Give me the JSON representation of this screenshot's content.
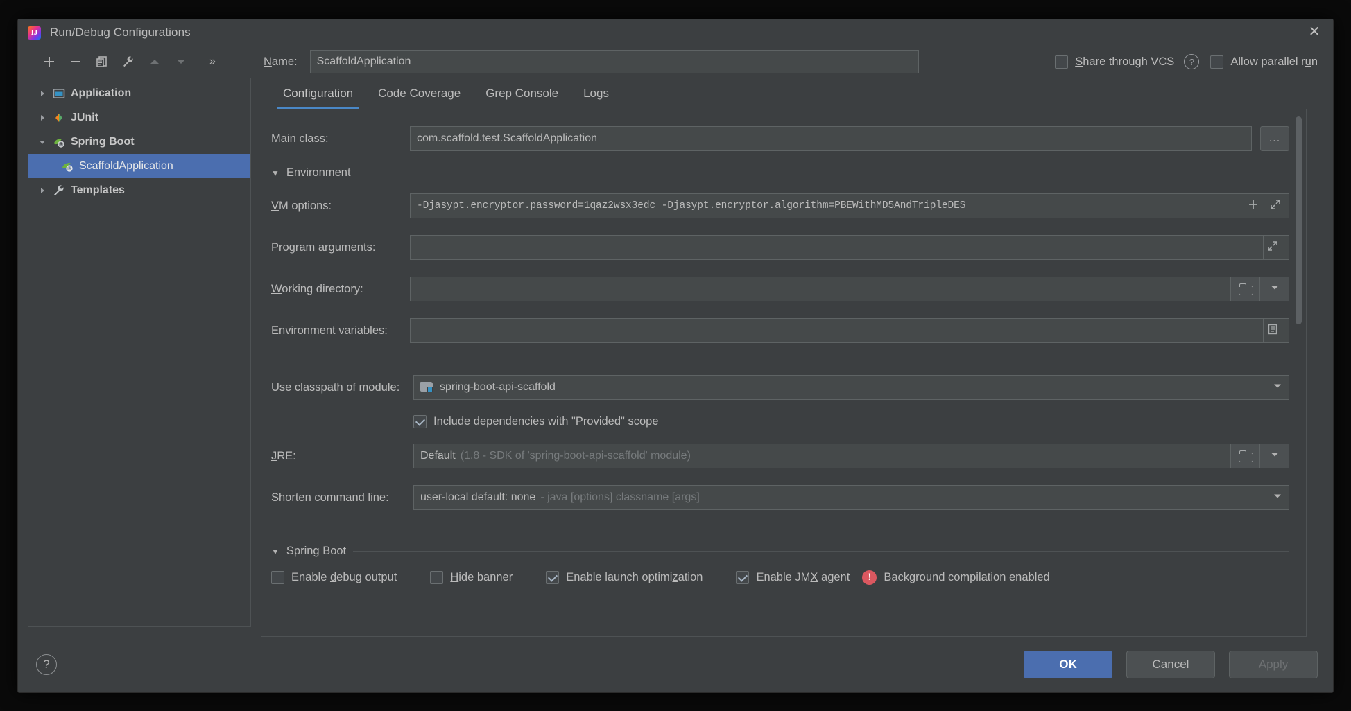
{
  "window": {
    "title": "Run/Debug Configurations",
    "app_icon": "intellij-idea-icon",
    "close_label": "✕"
  },
  "toolbar": {
    "add": "+",
    "remove": "−",
    "copy": "copy-icon",
    "edit_templates": "wrench-icon",
    "move_up": "▲",
    "move_down": "▼",
    "more": "»"
  },
  "tree": {
    "items": [
      {
        "label": "Application",
        "icon": "application-icon",
        "expanded": false,
        "level": 0,
        "selected": false,
        "group": true
      },
      {
        "label": "JUnit",
        "icon": "junit-icon",
        "expanded": false,
        "level": 0,
        "selected": false,
        "group": true
      },
      {
        "label": "Spring Boot",
        "icon": "spring-boot-icon",
        "expanded": true,
        "level": 0,
        "selected": false,
        "group": true
      },
      {
        "label": "ScaffoldApplication",
        "icon": "spring-boot-icon",
        "expanded": null,
        "level": 1,
        "selected": true,
        "group": false
      },
      {
        "label": "Templates",
        "icon": "wrench-icon",
        "expanded": false,
        "level": 0,
        "selected": false,
        "group": true
      }
    ]
  },
  "name_row": {
    "label": "Name:",
    "label_mnemonic": "N",
    "value": "ScaffoldApplication",
    "share_through_vcs": {
      "label": "Share through VCS",
      "mnemonic": "S",
      "checked": false
    },
    "help": "?",
    "allow_parallel_run": {
      "label": "Allow parallel run",
      "mnemonic": "u",
      "checked": false
    }
  },
  "tabs": [
    {
      "label": "Configuration",
      "active": true
    },
    {
      "label": "Code Coverage",
      "active": false
    },
    {
      "label": "Grep Console",
      "active": false
    },
    {
      "label": "Logs",
      "active": false
    }
  ],
  "form": {
    "main_class": {
      "label": "Main class:",
      "value": "com.scaffold.test.ScaffoldApplication",
      "browse_button": "..."
    },
    "environment_section": {
      "title": "Environment",
      "mnemonic": "m",
      "expanded": true
    },
    "vm_options": {
      "label": "VM options:",
      "mnemonic": "V",
      "value": "-Djasypt.encryptor.password=1qaz2wsx3edc  -Djasypt.encryptor.algorithm=PBEWithMD5AndTripleDES",
      "macro_button": "+",
      "expand_button": "expand-icon"
    },
    "program_arguments": {
      "label": "Program arguments:",
      "mnemonic": "r",
      "value": "",
      "expand_button": "expand-icon"
    },
    "working_directory": {
      "label": "Working directory:",
      "mnemonic": "W",
      "value": "",
      "browse_button": "folder-icon",
      "dropdown_button": "chevron-down-icon"
    },
    "environment_variables": {
      "label": "Environment variables:",
      "mnemonic": "E",
      "value": "",
      "browse_button": "list-icon"
    },
    "classpath_module": {
      "label": "Use classpath of module:",
      "mnemonic": "d",
      "value": "spring-boot-api-scaffold",
      "module_icon": "module-icon",
      "dropdown_button": "chevron-down-icon"
    },
    "include_provided": {
      "label": "Include dependencies with \"Provided\" scope",
      "checked": true
    },
    "jre": {
      "label": "JRE:",
      "mnemonic": "J",
      "value": "Default",
      "value_hint": "(1.8 - SDK of 'spring-boot-api-scaffold' module)",
      "browse_button": "folder-icon",
      "dropdown_button": "chevron-down-icon"
    },
    "shorten_command_line": {
      "label": "Shorten command line:",
      "mnemonic": "l",
      "value": "user-local default: none",
      "value_hint": "- java [options] classname [args]",
      "dropdown_button": "chevron-down-icon"
    },
    "spring_boot_section": {
      "title": "Spring Boot",
      "mnemonic": "g",
      "expanded": true
    },
    "spring_boot_checks": [
      {
        "label": "Enable debug output",
        "mnemonic": "d",
        "checked": false
      },
      {
        "label": "Hide banner",
        "mnemonic": "H",
        "checked": false
      },
      {
        "label": "Enable launch optimization",
        "mnemonic": "z",
        "checked": true
      },
      {
        "label": "Enable JMX agent",
        "mnemonic": "X",
        "checked": true
      }
    ],
    "background_warning": {
      "icon": "error-icon",
      "text": "Background compilation enabled"
    }
  },
  "footer": {
    "help": "?",
    "ok": "OK",
    "cancel": "Cancel",
    "apply": "Apply"
  },
  "colors": {
    "accent": "#4b6eaf",
    "tab_underline": "#4a88c7",
    "panel_bg": "#3c3f41",
    "field_bg": "#45494a",
    "error": "#db5860"
  }
}
